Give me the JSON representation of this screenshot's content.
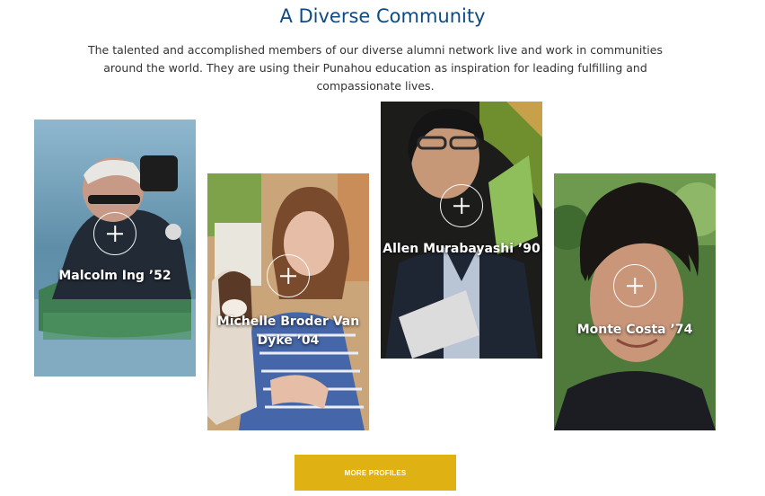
{
  "section": {
    "title": "A Diverse Community",
    "intro": "The talented and accomplished members of our diverse alumni network live and work in communities around the world. They are using their Punahou education as inspiration for leading fulfilling and compassionate lives."
  },
  "profiles": [
    {
      "name": "Malcolm Ing ’52"
    },
    {
      "name": "Michelle Broder Van Dyke ’04"
    },
    {
      "name": "Allen Murabayashi ’90"
    },
    {
      "name": "Monte Costa ’74"
    }
  ],
  "more_button": {
    "label": "MORE PROFILES"
  },
  "colors": {
    "title": "#0e4a86",
    "button": "#e0b112"
  }
}
